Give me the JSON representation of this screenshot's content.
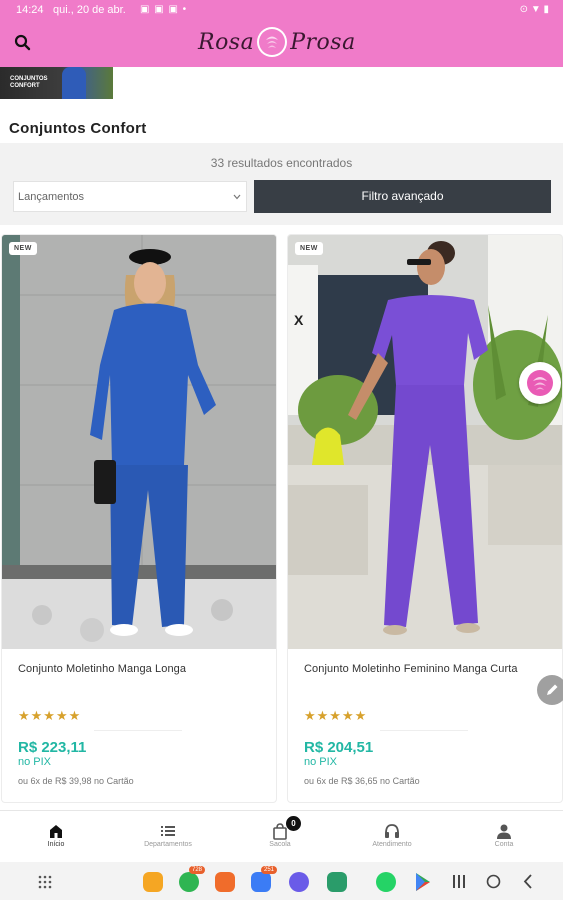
{
  "status_bar": {
    "time": "14:24",
    "date": "qui., 20 de abr.",
    "notifications": "▣ ▣ ▣ •",
    "right_icons": "⊙ ▼ ▮"
  },
  "header": {
    "logo_left": "Rosa",
    "logo_right": "Prosa",
    "search_icon": "search-icon"
  },
  "category_banner": {
    "line1": "CONJUNTOS",
    "line2": "CONFORT"
  },
  "page_title": "Conjuntos Confort",
  "filters": {
    "results": "33 resultados encontrados",
    "sort_selected": "Lançamentos",
    "advanced_filter": "Filtro avançado"
  },
  "products": [
    {
      "badge": "NEW",
      "name": "Conjunto Moletinho Manga Longa",
      "stars": "★★★★★",
      "price": "R$ 223,11",
      "pix": "no PIX",
      "installments": "ou 6x de R$ 39,98 no Cartão",
      "outfit_color": "#2d5fc0"
    },
    {
      "badge": "NEW",
      "name": "Conjunto Moletinho Feminino Manga Curta",
      "stars": "★★★★★",
      "price": "R$ 204,51",
      "pix": "no PIX",
      "installments": "ou 6x de R$ 36,65 no Cartão",
      "outfit_color": "#7a4fd6"
    }
  ],
  "bottom_nav": [
    {
      "label": "Início",
      "icon": "home-icon",
      "active": true
    },
    {
      "label": "Departamentos",
      "icon": "list-icon",
      "active": false
    },
    {
      "label": "Sacola",
      "icon": "bag-icon",
      "active": false,
      "badge": "0"
    },
    {
      "label": "Atendimento",
      "icon": "headset-icon",
      "active": false
    },
    {
      "label": "Conta",
      "icon": "person-icon",
      "active": false
    }
  ],
  "system_bar": {
    "badges": [
      "728",
      "251"
    ]
  },
  "colors": {
    "header_pink": "#f07bc9",
    "price_teal": "#22b7a4",
    "star_gold": "#d7a12c",
    "filter_button": "#383e45"
  }
}
